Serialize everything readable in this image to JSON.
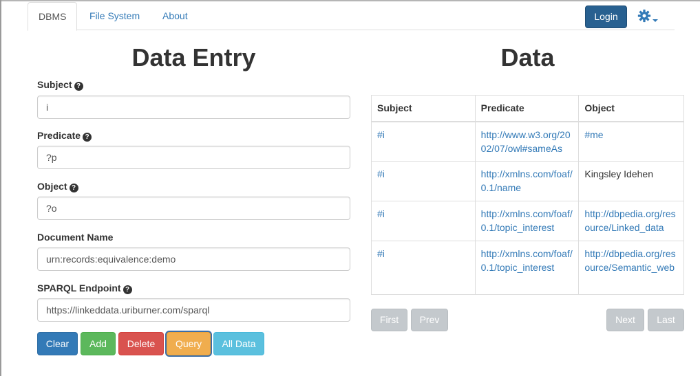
{
  "nav": {
    "tabs": [
      {
        "label": "DBMS"
      },
      {
        "label": "File System"
      },
      {
        "label": "About"
      }
    ],
    "login_label": "Login"
  },
  "entry": {
    "title": "Data Entry",
    "fields": {
      "subject": {
        "label": "Subject",
        "value": "i"
      },
      "predicate": {
        "label": "Predicate",
        "value": "?p"
      },
      "object": {
        "label": "Object",
        "value": "?o"
      },
      "document": {
        "label": "Document Name",
        "value": "urn:records:equivalence:demo"
      },
      "endpoint": {
        "label": "SPARQL Endpoint",
        "value": "https://linkeddata.uriburner.com/sparql"
      }
    },
    "buttons": {
      "clear": "Clear",
      "add": "Add",
      "delete": "Delete",
      "query": "Query",
      "all": "All Data"
    }
  },
  "data": {
    "title": "Data",
    "headers": [
      "Subject",
      "Predicate",
      "Object"
    ],
    "rows": [
      {
        "subject": "#i",
        "predicate": "http://www.w3.org/2002/07/owl#sameAs",
        "object": "#me"
      },
      {
        "subject": "#i",
        "predicate": "http://xmlns.com/foaf/0.1/name",
        "object": "Kingsley Idehen"
      },
      {
        "subject": "#i",
        "predicate": "http://xmlns.com/foaf/0.1/topic_interest",
        "object": "http://dbpedia.org/resource/Linked_data"
      },
      {
        "subject": "#i",
        "predicate": "http://xmlns.com/foaf/0.1/topic_interest",
        "object": "http://dbpedia.org/resource/Semantic_web"
      }
    ],
    "pager": {
      "first": "First",
      "prev": "Prev",
      "next": "Next",
      "last": "Last"
    }
  },
  "colors": {
    "primary": "#337ab7",
    "login": "#286090",
    "success": "#5cb85c",
    "danger": "#d9534f",
    "warning": "#f0ad4e",
    "info": "#5bc0de",
    "disabled": "#c4c9cd"
  },
  "icons": {
    "settings": "gear-icon",
    "help": "question-circle-icon"
  }
}
